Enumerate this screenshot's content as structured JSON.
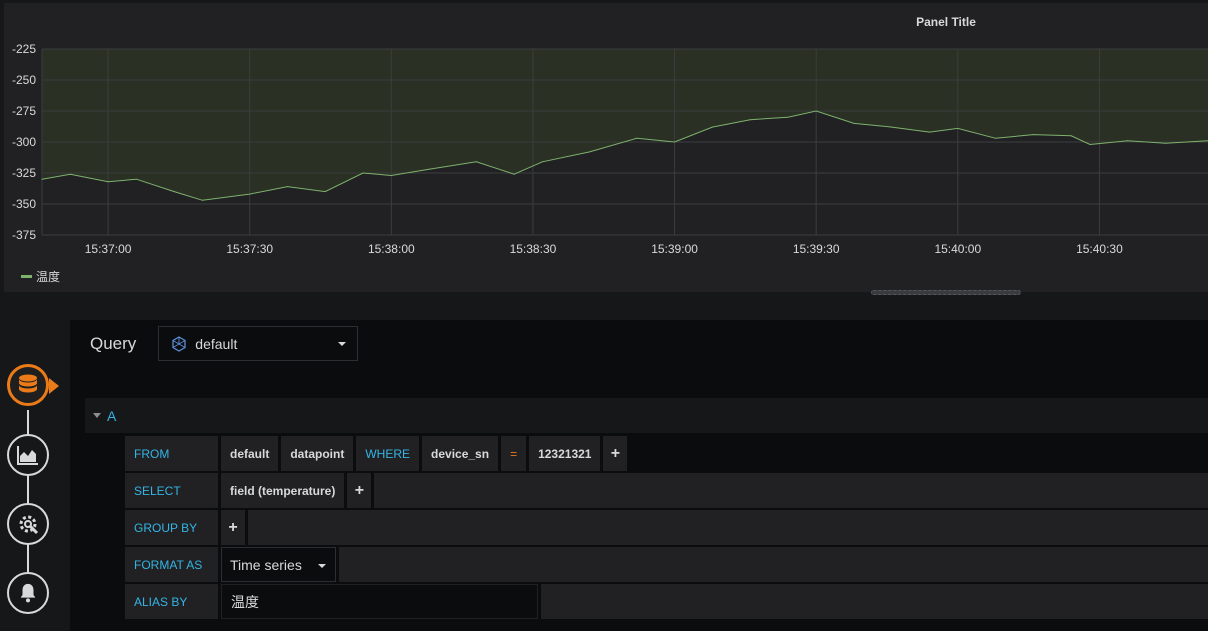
{
  "panel": {
    "title": "Panel Title",
    "legend": "温度"
  },
  "chart_data": {
    "type": "line",
    "title": "Panel Title",
    "x_ticks": [
      "15:37:00",
      "15:37:30",
      "15:38:00",
      "15:38:30",
      "15:39:00",
      "15:39:30",
      "15:40:00",
      "15:40:30"
    ],
    "y_ticks": [
      -225,
      -250,
      -275,
      -300,
      -325,
      -350,
      -375
    ],
    "ylim": [
      -375,
      -225
    ],
    "x_start": "15:36:46",
    "x_end": "15:40:53",
    "grid": true,
    "legend_position": "bottom-left",
    "series": [
      {
        "name": "温度",
        "color": "#7eb26d",
        "points": [
          [
            "15:36:46",
            -330
          ],
          [
            "15:36:52",
            -326
          ],
          [
            "15:37:00",
            -332
          ],
          [
            "15:37:06",
            -330
          ],
          [
            "15:37:14",
            -340
          ],
          [
            "15:37:20",
            -347
          ],
          [
            "15:37:30",
            -342
          ],
          [
            "15:37:38",
            -336
          ],
          [
            "15:37:46",
            -340
          ],
          [
            "15:37:54",
            -325
          ],
          [
            "15:38:00",
            -327
          ],
          [
            "15:38:08",
            -322
          ],
          [
            "15:38:18",
            -316
          ],
          [
            "15:38:26",
            -326
          ],
          [
            "15:38:32",
            -316
          ],
          [
            "15:38:42",
            -308
          ],
          [
            "15:38:52",
            -297
          ],
          [
            "15:39:00",
            -300
          ],
          [
            "15:39:08",
            -288
          ],
          [
            "15:39:16",
            -282
          ],
          [
            "15:39:24",
            -280
          ],
          [
            "15:39:30",
            -275
          ],
          [
            "15:39:38",
            -285
          ],
          [
            "15:39:46",
            -288
          ],
          [
            "15:39:54",
            -292
          ],
          [
            "15:40:00",
            -289
          ],
          [
            "15:40:08",
            -297
          ],
          [
            "15:40:16",
            -294
          ],
          [
            "15:40:24",
            -295
          ],
          [
            "15:40:28",
            -302
          ],
          [
            "15:40:36",
            -299
          ],
          [
            "15:40:44",
            -301
          ],
          [
            "15:40:53",
            -299
          ]
        ]
      }
    ]
  },
  "editor": {
    "title": "Query",
    "datasource": "default",
    "query_ref": "A",
    "rows": {
      "from_label": "FROM",
      "from_retention": "default",
      "from_measurement": "datapoint",
      "where_label": "WHERE",
      "where_key": "device_sn",
      "where_op": "=",
      "where_value": "12321321",
      "plus": "+",
      "select_label": "SELECT",
      "select_field": "field (temperature)",
      "group_label": "GROUP BY",
      "format_label": "FORMAT AS",
      "format_value": "Time series",
      "alias_label": "ALIAS BY",
      "alias_value": "温度"
    }
  },
  "nav": {
    "items": [
      "database-icon",
      "chart-icon",
      "settings-icon",
      "bell-icon"
    ],
    "accent": "#eb7b18"
  }
}
